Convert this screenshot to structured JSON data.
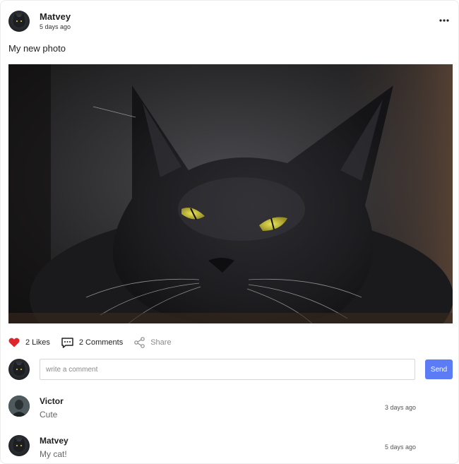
{
  "post": {
    "author": "Matvey",
    "time": "5 days ago",
    "text": "My new photo",
    "image_subject": "black long-haired cat with yellow eyes"
  },
  "actions": {
    "likes_label": "2 Likes",
    "comments_label": "2 Comments",
    "share_label": "Share",
    "like_color": "#e0242c"
  },
  "comment_form": {
    "placeholder": "write a comment",
    "send_label": "Send",
    "send_color": "#5b7cf5"
  },
  "comments": [
    {
      "author": "Victor",
      "text": "Cute",
      "time": "3 days ago"
    },
    {
      "author": "Matvey",
      "text": "My cat!",
      "time": "5 days ago"
    }
  ],
  "icons": {
    "more": "more-horizontal-icon",
    "like": "heart-icon",
    "comment": "comment-icon",
    "share": "share-icon"
  }
}
